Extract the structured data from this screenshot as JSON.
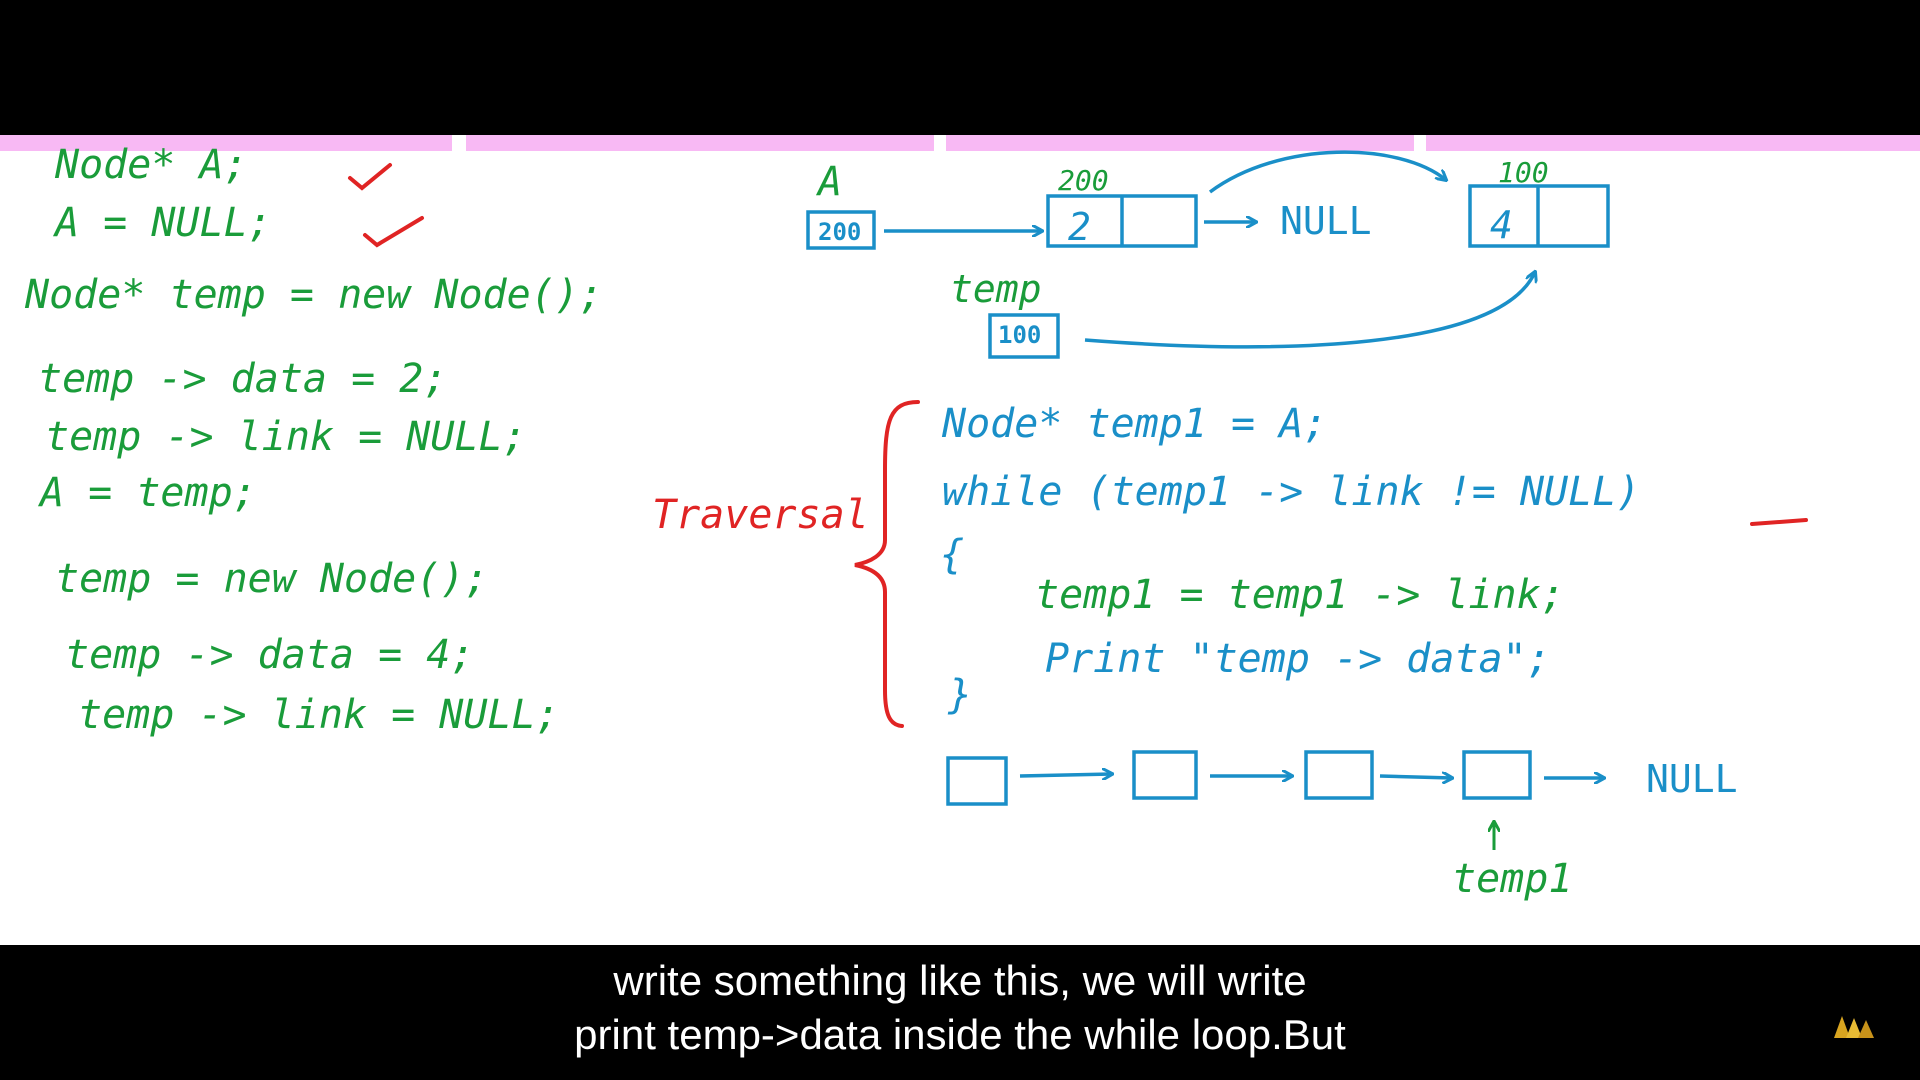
{
  "colors": {
    "code": "#1a9c3a",
    "diagram": "#1a8fc8",
    "accent": "#e02424",
    "board": "#ffffff",
    "highlight_bar": "#f8b9f4",
    "caption_bg": "#000000",
    "caption_fg": "#ffffff"
  },
  "left_code": [
    "Node* A;",
    "A = NULL;",
    "Node* temp = new Node();",
    "temp -> data = 2;",
    "temp -> link = NULL;",
    "A = temp;",
    "temp = new Node();",
    "temp -> data = 4;",
    "temp -> link = NULL;"
  ],
  "diagram": {
    "head_label": "A",
    "head_value": "200",
    "node1_address": "200",
    "node1_data": "2",
    "null_label": "NULL",
    "node2_address": "100",
    "node2_data": "4",
    "temp_label": "temp",
    "temp_value": "100"
  },
  "traversal": {
    "label": "Traversal",
    "lines": [
      "Node* temp1 = A;",
      "while (temp1 -> link != NULL)",
      "{",
      "temp1 = temp1 -> link;",
      "Print \"temp -> data\";",
      "}"
    ]
  },
  "list_diagram": {
    "null_label": "NULL",
    "pointer_label": "temp1"
  },
  "captions": [
    "write something like this, we will write",
    "print temp->data inside the while loop.But"
  ],
  "icons": {
    "check": "check-icon",
    "logo": "logo-icon"
  }
}
